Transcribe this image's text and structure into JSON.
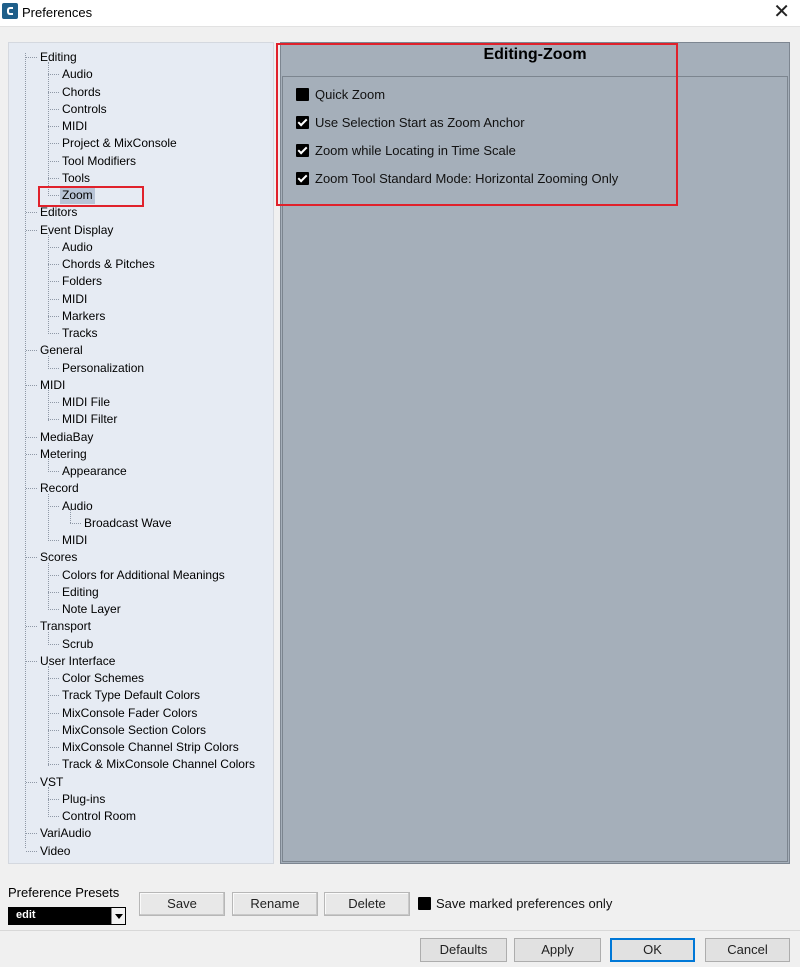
{
  "window": {
    "title": "Preferences"
  },
  "tree": [
    {
      "label": "Editing",
      "level": 0
    },
    {
      "label": "Audio",
      "level": 1
    },
    {
      "label": "Chords",
      "level": 1
    },
    {
      "label": "Controls",
      "level": 1
    },
    {
      "label": "MIDI",
      "level": 1
    },
    {
      "label": "Project & MixConsole",
      "level": 1
    },
    {
      "label": "Tool Modifiers",
      "level": 1
    },
    {
      "label": "Tools",
      "level": 1
    },
    {
      "label": "Zoom",
      "level": 1,
      "selected": true
    },
    {
      "label": "Editors",
      "level": 0
    },
    {
      "label": "Event Display",
      "level": 0
    },
    {
      "label": "Audio",
      "level": 1
    },
    {
      "label": "Chords & Pitches",
      "level": 1
    },
    {
      "label": "Folders",
      "level": 1
    },
    {
      "label": "MIDI",
      "level": 1
    },
    {
      "label": "Markers",
      "level": 1
    },
    {
      "label": "Tracks",
      "level": 1
    },
    {
      "label": "General",
      "level": 0
    },
    {
      "label": "Personalization",
      "level": 1
    },
    {
      "label": "MIDI",
      "level": 0
    },
    {
      "label": "MIDI File",
      "level": 1
    },
    {
      "label": "MIDI Filter",
      "level": 1
    },
    {
      "label": "MediaBay",
      "level": 0
    },
    {
      "label": "Metering",
      "level": 0
    },
    {
      "label": "Appearance",
      "level": 1
    },
    {
      "label": "Record",
      "level": 0
    },
    {
      "label": "Audio",
      "level": 1
    },
    {
      "label": "Broadcast Wave",
      "level": 2
    },
    {
      "label": "MIDI",
      "level": 1
    },
    {
      "label": "Scores",
      "level": 0
    },
    {
      "label": "Colors for Additional Meanings",
      "level": 1
    },
    {
      "label": "Editing",
      "level": 1
    },
    {
      "label": "Note Layer",
      "level": 1
    },
    {
      "label": "Transport",
      "level": 0
    },
    {
      "label": "Scrub",
      "level": 1
    },
    {
      "label": "User Interface",
      "level": 0
    },
    {
      "label": "Color Schemes",
      "level": 1
    },
    {
      "label": "Track Type Default Colors",
      "level": 1
    },
    {
      "label": "MixConsole Fader Colors",
      "level": 1
    },
    {
      "label": "MixConsole Section Colors",
      "level": 1
    },
    {
      "label": "MixConsole Channel Strip Colors",
      "level": 1
    },
    {
      "label": "Track & MixConsole Channel Colors",
      "level": 1
    },
    {
      "label": "VST",
      "level": 0
    },
    {
      "label": "Plug-ins",
      "level": 1
    },
    {
      "label": "Control Room",
      "level": 1
    },
    {
      "label": "VariAudio",
      "level": 0
    },
    {
      "label": "Video",
      "level": 0
    }
  ],
  "page": {
    "title": "Editing-Zoom",
    "options": [
      {
        "label": "Quick Zoom",
        "checked": false
      },
      {
        "label": "Use Selection Start as Zoom Anchor",
        "checked": true
      },
      {
        "label": "Zoom while Locating in Time Scale",
        "checked": true
      },
      {
        "label": "Zoom Tool Standard Mode: Horizontal Zooming Only",
        "checked": true
      }
    ]
  },
  "presets": {
    "label": "Preference Presets",
    "selected": "edit",
    "save_label": "Save",
    "rename_label": "Rename",
    "delete_label": "Delete",
    "save_marked_label": "Save marked preferences only",
    "save_marked_checked": false
  },
  "footer": {
    "defaults_label": "Defaults",
    "apply_label": "Apply",
    "ok_label": "OK",
    "cancel_label": "Cancel"
  },
  "colors": {
    "highlight": "#e0212b",
    "panel": "#a5afba",
    "tree_bg": "#e6ebf3"
  }
}
